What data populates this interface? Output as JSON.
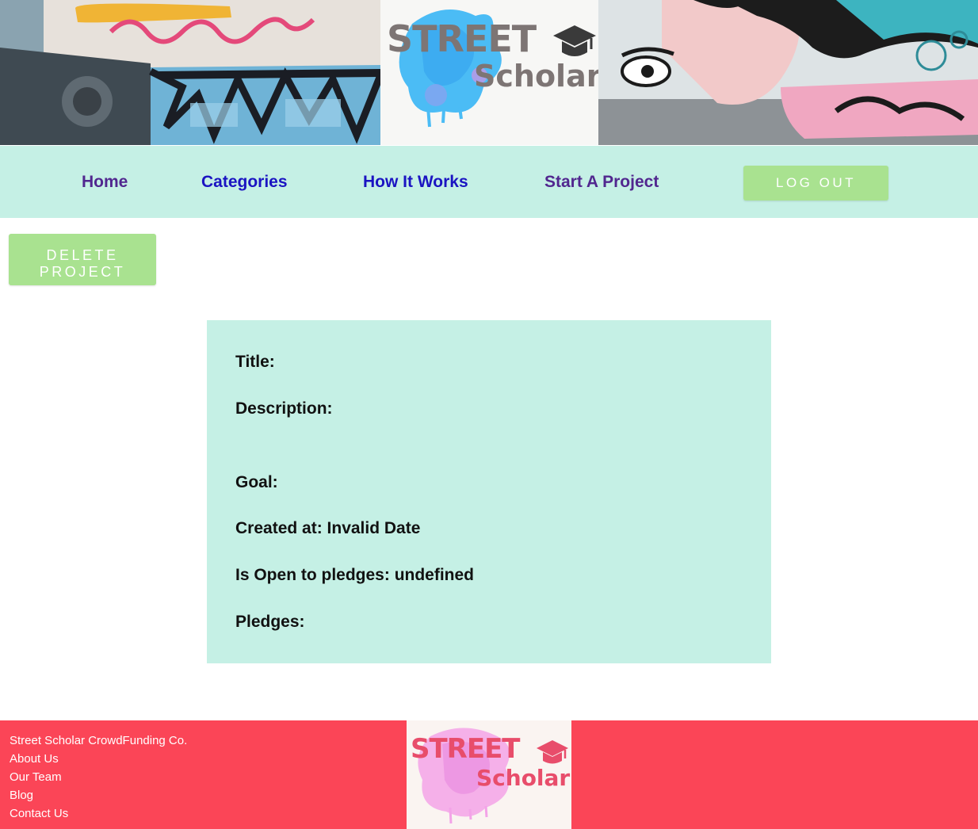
{
  "brand": {
    "logo_line1": "STREET",
    "logo_line2": "Scholar",
    "colors": {
      "nav_bg": "#c5f0e5",
      "button": "#a9e290",
      "footer": "#fb4557",
      "nav_purple": "#51278f",
      "nav_blue": "#1b14c2"
    }
  },
  "nav": {
    "home": "Home",
    "categories": "Categories",
    "how_it_works": "How It Works",
    "start_project": "Start A Project",
    "logout": "LOG OUT"
  },
  "actions": {
    "delete_line1": "DELETE",
    "delete_line2": "PROJECT"
  },
  "project": {
    "title": "Title:",
    "description": "Description:",
    "goal": "Goal:",
    "created": "Created at: Invalid Date",
    "is_open": "Is Open to pledges: undefined",
    "pledges": "Pledges:"
  },
  "footer": {
    "company": "Street Scholar CrowdFunding Co.",
    "about": "About Us",
    "team": "Our Team",
    "blog": "Blog",
    "contact": "Contact Us"
  }
}
